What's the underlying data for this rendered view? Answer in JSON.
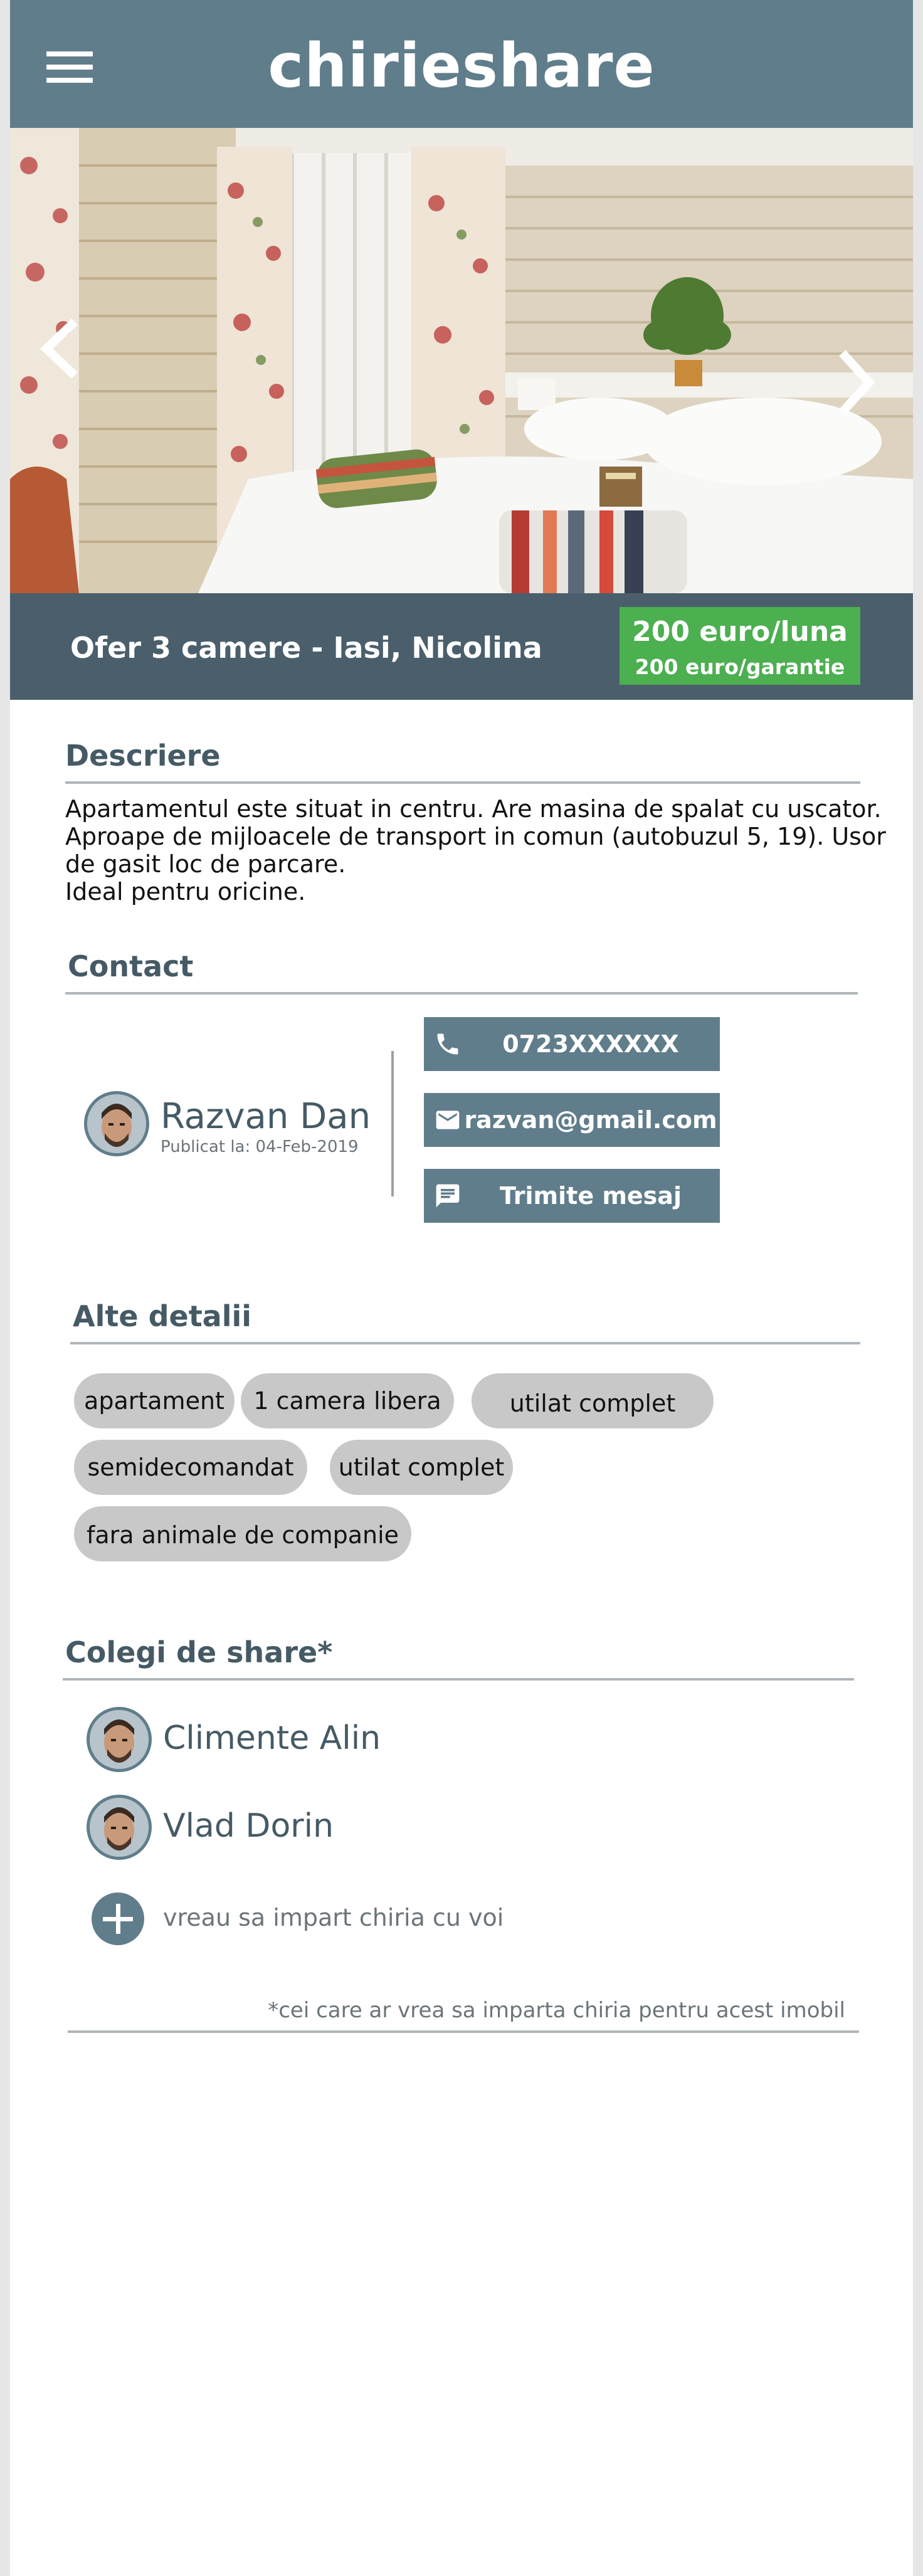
{
  "header": {
    "brand": "chirieshare",
    "menu_icon": "hamburger-menu-icon"
  },
  "carousel": {
    "prev_icon": "chevron-left-icon",
    "next_icon": "chevron-right-icon"
  },
  "listing": {
    "title": "Ofer 3 camere - Iasi, Nicolina",
    "price": "200 euro/luna",
    "deposit": "200 euro/garantie"
  },
  "description": {
    "heading": "Descriere",
    "lines": [
      "Apartamentul este situat in centru. Are masina de spalat cu uscator.",
      "Aproape de mijloacele de transport in comun (autobuzul 5, 19). Usor",
      "de gasit loc de parcare.",
      "Ideal pentru oricine."
    ]
  },
  "contact": {
    "heading": "Contact",
    "owner_name": "Razvan Dan",
    "published": "Publicat la: 04-Feb-2019",
    "phone": "0723XXXXXX",
    "email": "razvan@gmail.com",
    "message_label": "Trimite mesaj",
    "icons": [
      "phone-icon",
      "mail-icon",
      "chat-icon"
    ]
  },
  "details": {
    "heading": "Alte detalii",
    "tags": [
      "apartament",
      "1 camera libera",
      "utilat complet",
      "semidecomandat",
      "utilat complet",
      "fara animale de companie"
    ]
  },
  "roommates": {
    "heading": "Colegi de share*",
    "people": [
      "Climente Alin",
      "Vlad Dorin"
    ],
    "add_label": "vreau sa impart chiria cu voi",
    "footnote": "*cei care ar vrea sa imparta chiria pentru acest imobil"
  },
  "colors": {
    "primary": "#607d8b",
    "band": "#4a5f6b",
    "price": "#4caf50",
    "tag": "#c8c8c8",
    "heading": "#455a64"
  }
}
